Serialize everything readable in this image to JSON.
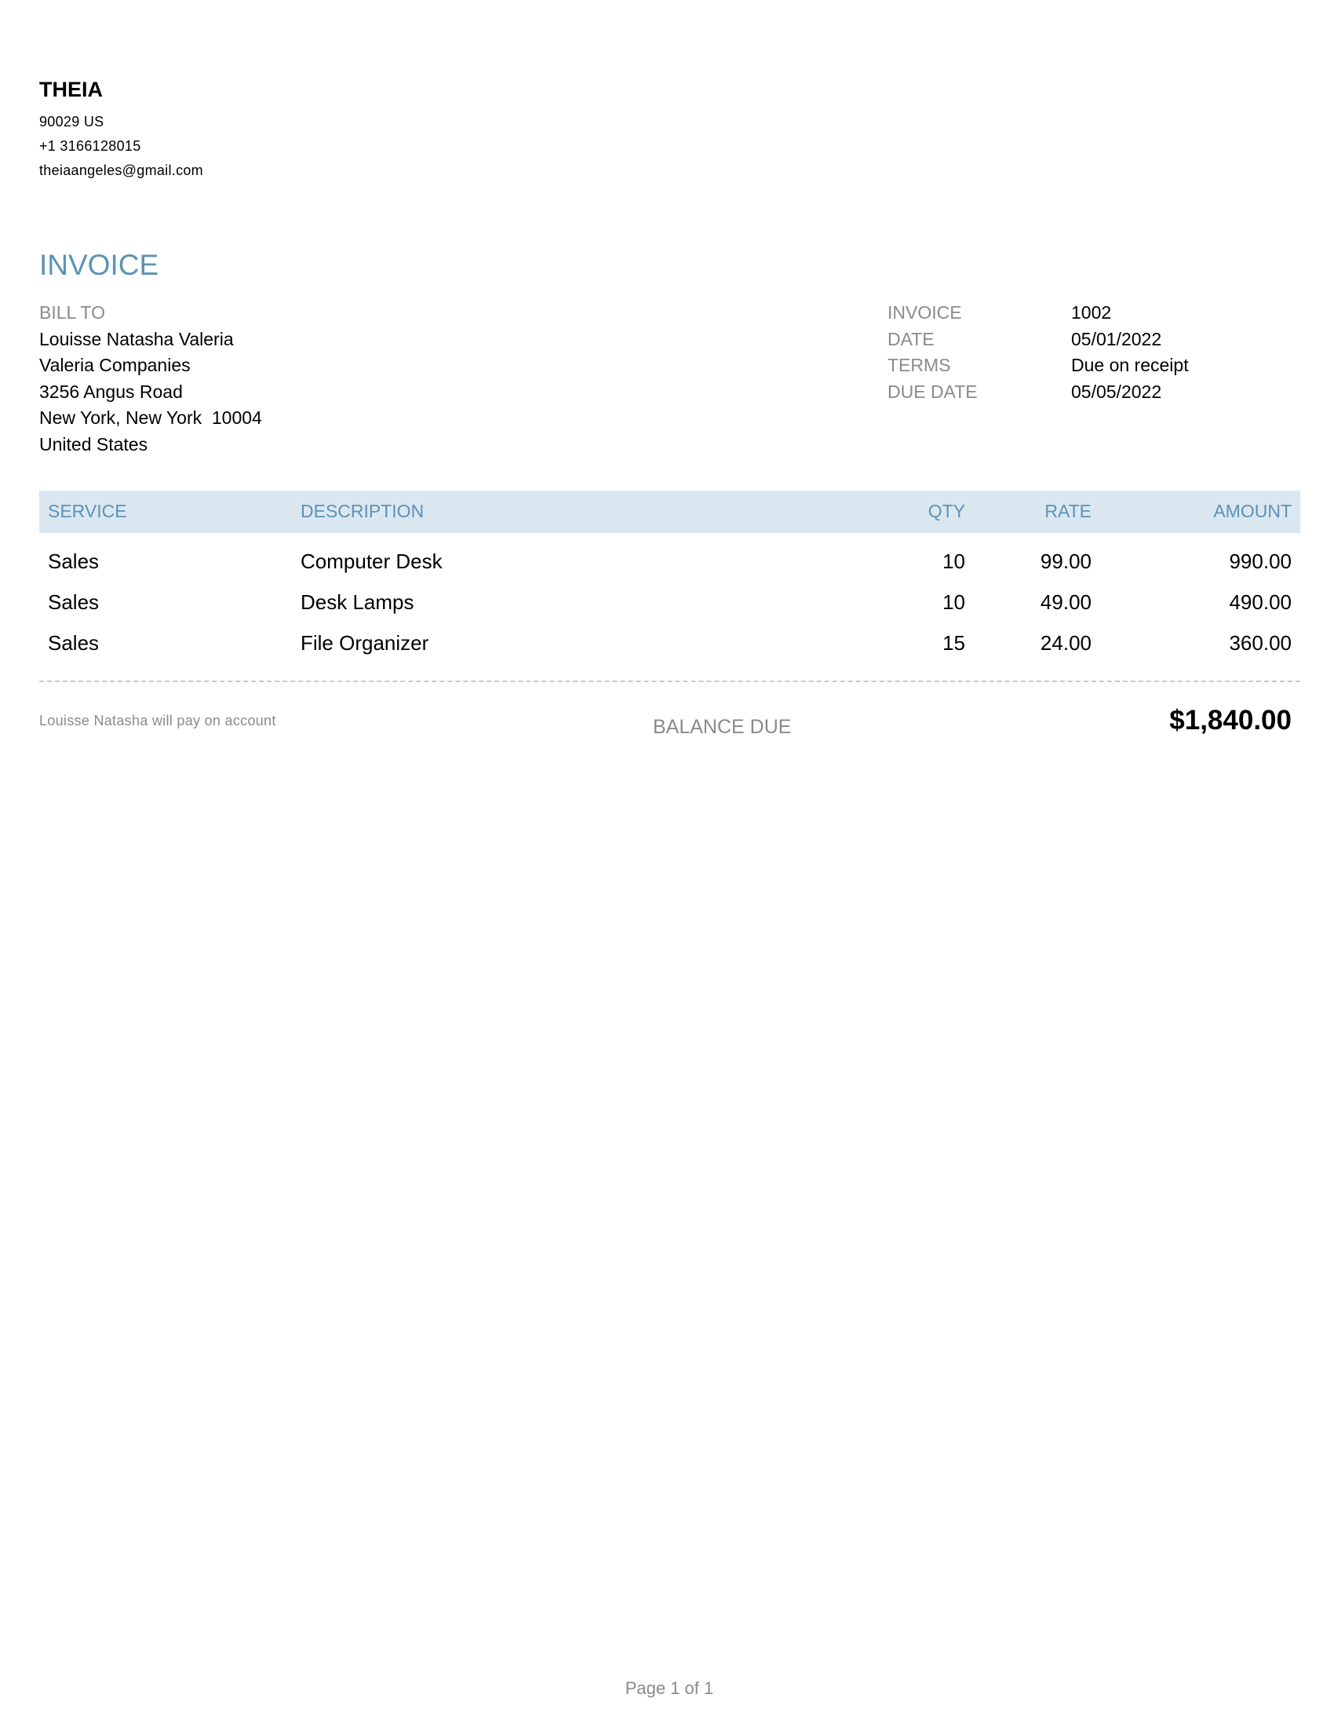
{
  "company": {
    "name": "THEIA",
    "address": "90029 US",
    "phone": "+1 3166128015",
    "email": "theiaangeles@gmail.com"
  },
  "document": {
    "title": "INVOICE"
  },
  "bill_to": {
    "label": "BILL TO",
    "name": "Louisse Natasha Valeria",
    "company": "Valeria Companies",
    "street": "3256 Angus Road",
    "city_line": "New York, New York  10004",
    "country": "United States"
  },
  "meta": {
    "invoice_label": "INVOICE",
    "invoice_value": "1002",
    "date_label": "DATE",
    "date_value": "05/01/2022",
    "terms_label": "TERMS",
    "terms_value": "Due on receipt",
    "due_date_label": "DUE DATE",
    "due_date_value": "05/05/2022"
  },
  "table": {
    "headers": {
      "service": "SERVICE",
      "description": "DESCRIPTION",
      "qty": "QTY",
      "rate": "RATE",
      "amount": "AMOUNT"
    },
    "rows": [
      {
        "service": "Sales",
        "description": "Computer Desk",
        "qty": "10",
        "rate": "99.00",
        "amount": "990.00"
      },
      {
        "service": "Sales",
        "description": "Desk Lamps",
        "qty": "10",
        "rate": "49.00",
        "amount": "490.00"
      },
      {
        "service": "Sales",
        "description": "File Organizer",
        "qty": "15",
        "rate": "24.00",
        "amount": "360.00"
      }
    ]
  },
  "footer": {
    "note": "Louisse Natasha will pay on account",
    "balance_label": "BALANCE DUE",
    "balance_value": "$1,840.00"
  },
  "page": {
    "number_text": "Page 1 of 1"
  },
  "colors": {
    "accent": "#5b93b5",
    "header_bg": "#dbe7f0",
    "muted": "#8a8a8a"
  }
}
